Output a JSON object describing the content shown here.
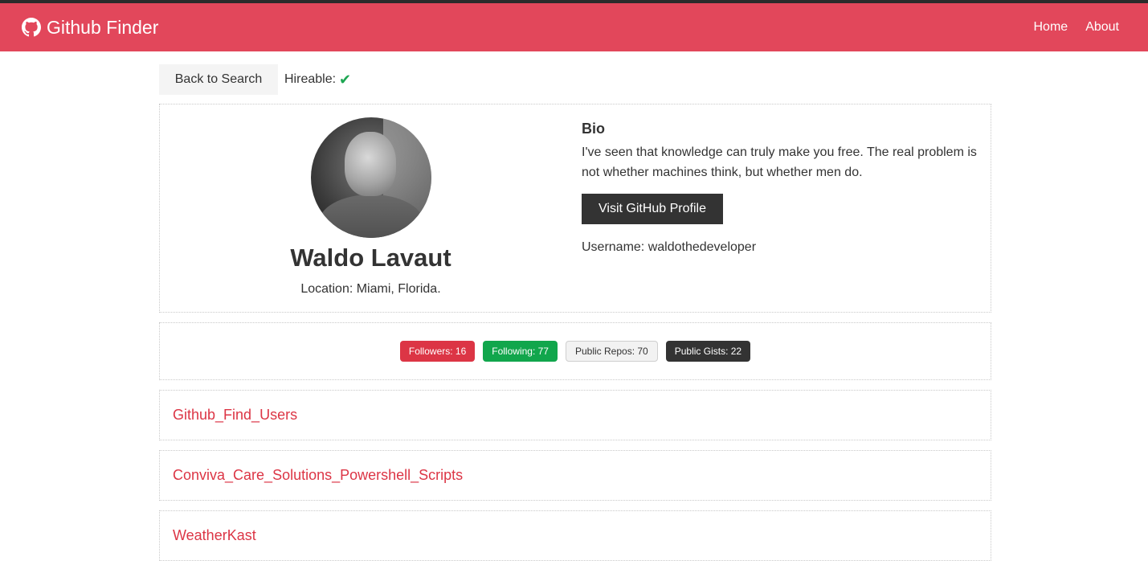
{
  "navbar": {
    "brand": "Github Finder",
    "links": [
      "Home",
      "About"
    ]
  },
  "topbar": {
    "back_label": "Back to Search",
    "hireable_label": "Hireable:",
    "hireable_icon": "check-icon"
  },
  "profile": {
    "name": "Waldo Lavaut",
    "location": "Location: Miami, Florida.",
    "bio_title": "Bio",
    "bio": "I've seen that knowledge can truly make you free. The real problem is not whether machines think, but whether men do.",
    "visit_label": "Visit GitHub Profile",
    "username": "Username: waldothedeveloper"
  },
  "stats": {
    "followers": "Followers: 16",
    "following": "Following: 77",
    "public_repos": "Public Repos: 70",
    "public_gists": "Public Gists: 22"
  },
  "repos": [
    "Github_Find_Users",
    "Conviva_Care_Solutions_Powershell_Scripts",
    "WeatherKast"
  ],
  "colors": {
    "navbar": "#e2475b",
    "accent_red": "#dc3545",
    "green": "#11a64c",
    "dark": "#333333"
  }
}
